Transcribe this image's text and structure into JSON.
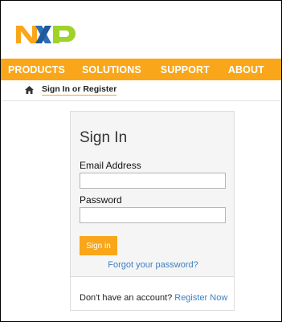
{
  "brand": {
    "logo_text": "NXP",
    "colors": {
      "n": "#f9a61a",
      "x": "#2d6db6",
      "p": "#9fd22a",
      "accent": "#f9a61a",
      "link": "#3d7fc0"
    }
  },
  "nav": {
    "items": [
      "PRODUCTS",
      "SOLUTIONS",
      "SUPPORT",
      "ABOUT"
    ]
  },
  "breadcrumb": {
    "home_icon": "home-icon",
    "current": "Sign In or Register"
  },
  "signin": {
    "title": "Sign In",
    "email_label": "Email Address",
    "email_value": "",
    "password_label": "Password",
    "password_value": "",
    "button_label": "Sign in",
    "forgot_label": "Forgot your password?",
    "no_account_text": "Don't have an account?",
    "register_label": "Register Now"
  }
}
